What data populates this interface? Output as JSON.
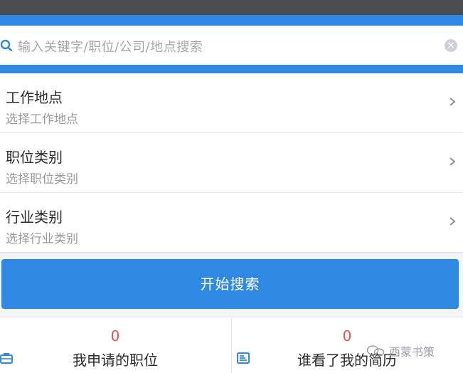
{
  "search": {
    "placeholder": "输入关键字/职位/公司/地点搜索"
  },
  "filters": [
    {
      "title": "工作地点",
      "subtitle": "选择工作地点"
    },
    {
      "title": "职位类别",
      "subtitle": "选择职位类别"
    },
    {
      "title": "行业类别",
      "subtitle": "选择行业类别"
    }
  ],
  "actions": {
    "start_search_label": "开始搜索"
  },
  "stats": {
    "applied": {
      "count": "0",
      "label": "我申请的职位"
    },
    "viewed": {
      "count": "0",
      "label": "谁看了我的简历"
    }
  },
  "watermark": "西蒙书策",
  "colors": {
    "accent": "#2f89e3",
    "count": "#e8504f"
  }
}
